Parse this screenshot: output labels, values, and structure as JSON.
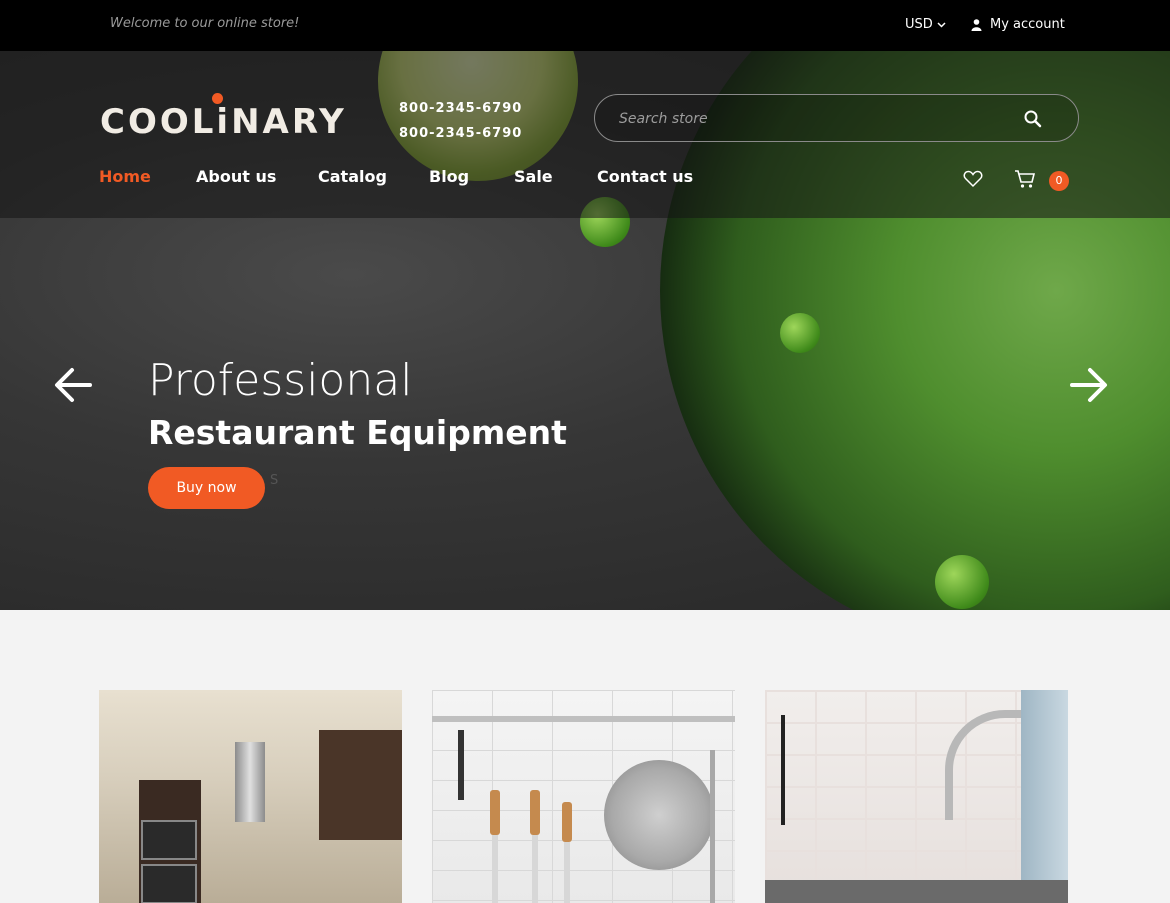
{
  "topbar": {
    "welcome": "Welcome to our online store!",
    "currency": "USD",
    "account": "My account"
  },
  "header": {
    "logo": "COOLiNARY",
    "phones": [
      "800-2345-6790",
      "800-2345-6790"
    ],
    "search_placeholder": "Search store",
    "nav": [
      "Home",
      "About us",
      "Catalog",
      "Blog",
      "Sale",
      "Contact us"
    ],
    "active_nav": "Home",
    "cart_count": "0"
  },
  "slider": {
    "line1": "Professional",
    "line2": "Restaurant Equipment",
    "button": "Buy now",
    "stray": "S"
  },
  "colors": {
    "accent": "#f15a24",
    "topbar": "#000000",
    "page_bg": "#f3f3f3"
  },
  "icons": {
    "currency_dropdown": "chevron-down-icon",
    "account": "user-icon",
    "search": "search-icon",
    "wishlist": "heart-icon",
    "cart": "cart-icon",
    "prev": "arrow-left-icon",
    "next": "arrow-right-icon"
  },
  "cards": [
    {
      "image": "kitchen-interior"
    },
    {
      "image": "kitchen-utensils"
    },
    {
      "image": "kitchen-faucet"
    }
  ]
}
